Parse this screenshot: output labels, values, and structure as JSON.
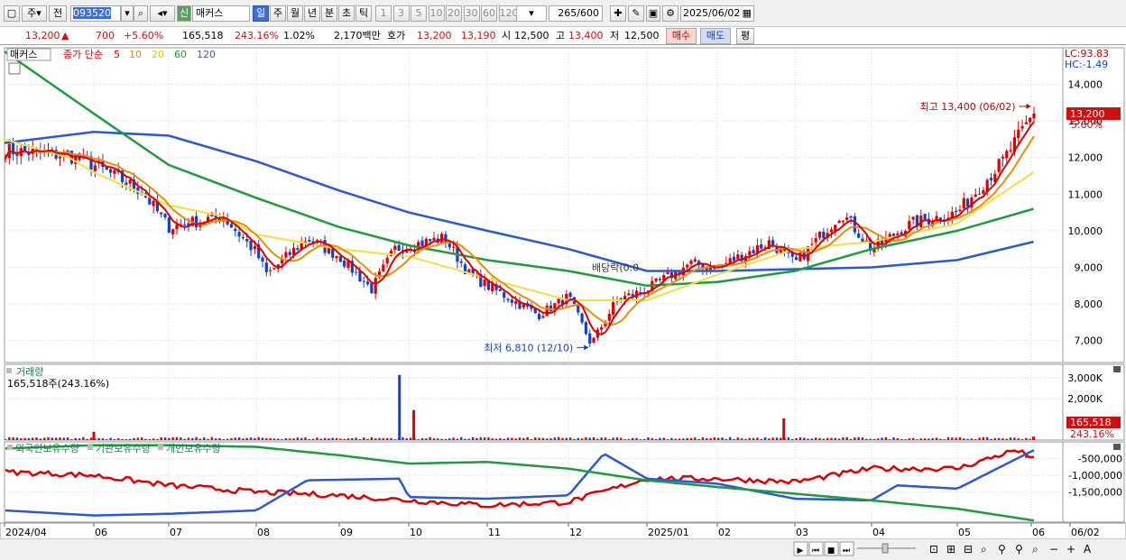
{
  "toolbar": {
    "period": "주",
    "prev_label": "전",
    "code": "093520",
    "name_tag": "신",
    "name": "매커스",
    "tabs": [
      "일",
      "주",
      "월",
      "년",
      "분",
      "초",
      "틱"
    ],
    "active_tab": "일",
    "intervals": [
      "1",
      "3",
      "5",
      "10",
      "20",
      "30",
      "60",
      "120"
    ],
    "count": "265",
    "count_total": "/600",
    "date": "2025/06/02"
  },
  "quote": {
    "price": "13,200",
    "arrow": "▲",
    "change": "700",
    "change_pct": "+5.60%",
    "volume": "165,518",
    "volume_ratio": "243.16%",
    "turnover": "1.02%",
    "amount": "2,170백만",
    "bid_ask_label": "호가",
    "ask": "13,200",
    "bid": "13,190",
    "open_label": "시",
    "open": "12,500",
    "high_label": "고",
    "high": "13,400",
    "low_label": "저",
    "low": "12,500",
    "buy_button": "매수",
    "sell_button": "매도",
    "eval_button": "평"
  },
  "colors": {
    "up": "#e00000",
    "down": "#1040d0",
    "ma5": "#e00000",
    "ma10": "#f08c00",
    "ma20": "#f0e040",
    "ma60": "#1e9b3a",
    "ma120": "#2a58d8",
    "foreign": "#e00000",
    "institution": "#2a58d8",
    "individual": "#1e9b3a",
    "panel_title": "#1e7a50"
  },
  "chart_data": [
    {
      "type": "candlestick",
      "title": "매커스",
      "legend": {
        "label": "종가 단순",
        "items": [
          {
            "name": "5",
            "color": "#e00000"
          },
          {
            "name": "10",
            "color": "#f08c00"
          },
          {
            "name": "20",
            "color": "#e0c800"
          },
          {
            "name": "60",
            "color": "#1e9b3a"
          },
          {
            "name": "120",
            "color": "#2a58d8"
          }
        ]
      },
      "ylim": [
        6400,
        15000
      ],
      "y_ticks": [
        "14,000",
        "13,000",
        "12,000",
        "11,000",
        "10,000",
        "9,000",
        "8,000",
        "7,000"
      ],
      "y_tick_values": [
        14000,
        13000,
        12000,
        11000,
        10000,
        9000,
        8000,
        7000
      ],
      "x_ticks": [
        "2024/04",
        "06",
        "07",
        "08",
        "09",
        "10",
        "11",
        "12",
        "2025/01",
        "02",
        "03",
        "04",
        "05",
        "06",
        "06/02"
      ],
      "lc_label": "LC:93.83",
      "hc_label": "HC:-1.49",
      "current_price_label": "13,200",
      "current_pct_label": "5.60%",
      "annotations": [
        {
          "text": "최고 13,400 (06/02)",
          "value": 13400,
          "date": "2025/06/02"
        },
        {
          "text": "최저 6,810 (12/10)",
          "value": 6810,
          "date": "2024/12/10"
        },
        {
          "text": "배당락(0.0",
          "date": "2024/12/27"
        }
      ],
      "close_series": [
        {
          "date": "2024/04",
          "value": 12200
        },
        {
          "date": "2024/05/15",
          "value": 12050
        },
        {
          "date": "2024/06",
          "value": 11800
        },
        {
          "date": "2024/06/20",
          "value": 11100
        },
        {
          "date": "2024/07",
          "value": 10100
        },
        {
          "date": "2024/07/20",
          "value": 10400
        },
        {
          "date": "2024/08",
          "value": 9400
        },
        {
          "date": "2024/08/05",
          "value": 8800
        },
        {
          "date": "2024/08/20",
          "value": 9800
        },
        {
          "date": "2024/09",
          "value": 9300
        },
        {
          "date": "2024/09/15",
          "value": 8400
        },
        {
          "date": "2024/09/25",
          "value": 9500
        },
        {
          "date": "2024/10",
          "value": 9600
        },
        {
          "date": "2024/10/15",
          "value": 9800
        },
        {
          "date": "2024/10/25",
          "value": 8800
        },
        {
          "date": "2024/11",
          "value": 8500
        },
        {
          "date": "2024/11/20",
          "value": 7700
        },
        {
          "date": "2024/12",
          "value": 8200
        },
        {
          "date": "2024/12/10",
          "value": 6900
        },
        {
          "date": "2024/12/20",
          "value": 8100
        },
        {
          "date": "2025/01",
          "value": 8400
        },
        {
          "date": "2025/01/20",
          "value": 9100
        },
        {
          "date": "2025/02",
          "value": 9000
        },
        {
          "date": "2025/02/20",
          "value": 9700
        },
        {
          "date": "2025/03",
          "value": 9100
        },
        {
          "date": "2025/03/20",
          "value": 10500
        },
        {
          "date": "2025/04",
          "value": 9500
        },
        {
          "date": "2025/04/15",
          "value": 10200
        },
        {
          "date": "2025/05",
          "value": 10500
        },
        {
          "date": "2025/05/20",
          "value": 11900
        },
        {
          "date": "2025/06/02",
          "value": 13200
        }
      ],
      "ma60": [
        {
          "date": "2024/04",
          "value": 14900
        },
        {
          "date": "2024/06",
          "value": 13200
        },
        {
          "date": "2024/07",
          "value": 11800
        },
        {
          "date": "2024/08",
          "value": 10900
        },
        {
          "date": "2024/09",
          "value": 10100
        },
        {
          "date": "2024/10",
          "value": 9600
        },
        {
          "date": "2024/11",
          "value": 9200
        },
        {
          "date": "2024/12",
          "value": 8900
        },
        {
          "date": "2025/01",
          "value": 8500
        },
        {
          "date": "2025/02",
          "value": 8600
        },
        {
          "date": "2025/03",
          "value": 8900
        },
        {
          "date": "2025/04",
          "value": 9500
        },
        {
          "date": "2025/05",
          "value": 10000
        },
        {
          "date": "2025/06/02",
          "value": 10600
        }
      ],
      "ma120": [
        {
          "date": "2024/04",
          "value": 12400
        },
        {
          "date": "2024/06",
          "value": 12700
        },
        {
          "date": "2024/07",
          "value": 12600
        },
        {
          "date": "2024/08",
          "value": 11900
        },
        {
          "date": "2024/09",
          "value": 11100
        },
        {
          "date": "2024/10",
          "value": 10500
        },
        {
          "date": "2024/11",
          "value": 10000
        },
        {
          "date": "2024/12",
          "value": 9500
        },
        {
          "date": "2025/01",
          "value": 8900
        },
        {
          "date": "2025/02",
          "value": 8900
        },
        {
          "date": "2025/03",
          "value": 8950
        },
        {
          "date": "2025/04",
          "value": 9000
        },
        {
          "date": "2025/05",
          "value": 9200
        },
        {
          "date": "2025/06/02",
          "value": 9700
        }
      ],
      "ma20": [
        {
          "date": "2024/04",
          "value": 12500
        },
        {
          "date": "2024/05/15",
          "value": 12000
        },
        {
          "date": "2024/06",
          "value": 11600
        },
        {
          "date": "2024/07",
          "value": 10700
        },
        {
          "date": "2024/07/20",
          "value": 10400
        },
        {
          "date": "2024/08",
          "value": 9900
        },
        {
          "date": "2024/09",
          "value": 9500
        },
        {
          "date": "2024/10",
          "value": 9300
        },
        {
          "date": "2024/11",
          "value": 8700
        },
        {
          "date": "2024/12",
          "value": 8100
        },
        {
          "date": "2025/01",
          "value": 8100
        },
        {
          "date": "2025/02",
          "value": 8800
        },
        {
          "date": "2025/03",
          "value": 9500
        },
        {
          "date": "2025/04",
          "value": 9700
        },
        {
          "date": "2025/05",
          "value": 10200
        },
        {
          "date": "2025/06/02",
          "value": 11600
        }
      ]
    },
    {
      "type": "bar",
      "title": "거래량",
      "info": "165,518주(243.16%)",
      "y_ticks": [
        "3,000K",
        "2,000K"
      ],
      "y_tick_values": [
        3000000,
        2000000
      ],
      "ylim": [
        0,
        3400000
      ],
      "current_label": "165,518",
      "current_pct": "243.16%",
      "spikes": [
        {
          "date": "2024/06",
          "value": 400000
        },
        {
          "date": "2024/09/27",
          "value": 3150000
        },
        {
          "date": "2024/10/03",
          "value": 1450000
        },
        {
          "date": "2025/02/25",
          "value": 1050000
        }
      ],
      "baseline_value": 90000,
      "last_value": 165518
    },
    {
      "type": "line",
      "series_names": [
        "외국인보유수량",
        "기관보유수량",
        "개인보유수량"
      ],
      "y_ticks": [
        "-500,000",
        "-1,000,000",
        "-1,500,000"
      ],
      "y_tick_values": [
        -500000,
        -1000000,
        -1500000
      ],
      "ylim": [
        -2400000,
        0
      ],
      "series": [
        {
          "name": "외국인보유수량",
          "color": "#e00000",
          "values": [
            {
              "date": "2024/04",
              "value": -900000
            },
            {
              "date": "2024/06",
              "value": -1000000
            },
            {
              "date": "2024/07",
              "value": -1300000
            },
            {
              "date": "2024/08",
              "value": -1500000
            },
            {
              "date": "2024/09",
              "value": -1600000
            },
            {
              "date": "2024/10",
              "value": -1750000
            },
            {
              "date": "2024/11",
              "value": -1900000
            },
            {
              "date": "2024/12",
              "value": -1800000
            },
            {
              "date": "2025/01",
              "value": -1100000
            },
            {
              "date": "2025/02",
              "value": -1100000
            },
            {
              "date": "2025/03",
              "value": -1200000
            },
            {
              "date": "2025/04",
              "value": -800000
            },
            {
              "date": "2025/05",
              "value": -800000
            },
            {
              "date": "2025/05/25",
              "value": -250000
            },
            {
              "date": "2025/06/02",
              "value": -450000
            }
          ]
        },
        {
          "name": "기관보유수량",
          "color": "#2a58d8",
          "values": [
            {
              "date": "2024/04",
              "value": -2050000
            },
            {
              "date": "2024/06",
              "value": -2200000
            },
            {
              "date": "2024/07",
              "value": -2150000
            },
            {
              "date": "2024/08",
              "value": -2050000
            },
            {
              "date": "2024/08/20",
              "value": -1150000
            },
            {
              "date": "2024/09/27",
              "value": -1100000
            },
            {
              "date": "2024/10",
              "value": -1650000
            },
            {
              "date": "2024/11",
              "value": -1700000
            },
            {
              "date": "2024/12",
              "value": -1600000
            },
            {
              "date": "2024/12/15",
              "value": -350000
            },
            {
              "date": "2025/01",
              "value": -1100000
            },
            {
              "date": "2025/02",
              "value": -1250000
            },
            {
              "date": "2025/03",
              "value": -1700000
            },
            {
              "date": "2025/04",
              "value": -1750000
            },
            {
              "date": "2025/04/10",
              "value": -1300000
            },
            {
              "date": "2025/05",
              "value": -1400000
            },
            {
              "date": "2025/06/02",
              "value": -250000
            }
          ]
        },
        {
          "name": "개인보유수량",
          "color": "#1e9b3a",
          "values": [
            {
              "date": "2024/04",
              "value": -200000
            },
            {
              "date": "2024/06",
              "value": -100000
            },
            {
              "date": "2024/07",
              "value": -100000
            },
            {
              "date": "2024/08",
              "value": -150000
            },
            {
              "date": "2024/09",
              "value": -400000
            },
            {
              "date": "2024/10",
              "value": -650000
            },
            {
              "date": "2024/11",
              "value": -600000
            },
            {
              "date": "2024/12",
              "value": -800000
            },
            {
              "date": "2025/01",
              "value": -1150000
            },
            {
              "date": "2025/02",
              "value": -1350000
            },
            {
              "date": "2025/03",
              "value": -1550000
            },
            {
              "date": "2025/04",
              "value": -1750000
            },
            {
              "date": "2025/05",
              "value": -2000000
            },
            {
              "date": "2025/06/02",
              "value": -2350000
            }
          ]
        }
      ]
    }
  ]
}
